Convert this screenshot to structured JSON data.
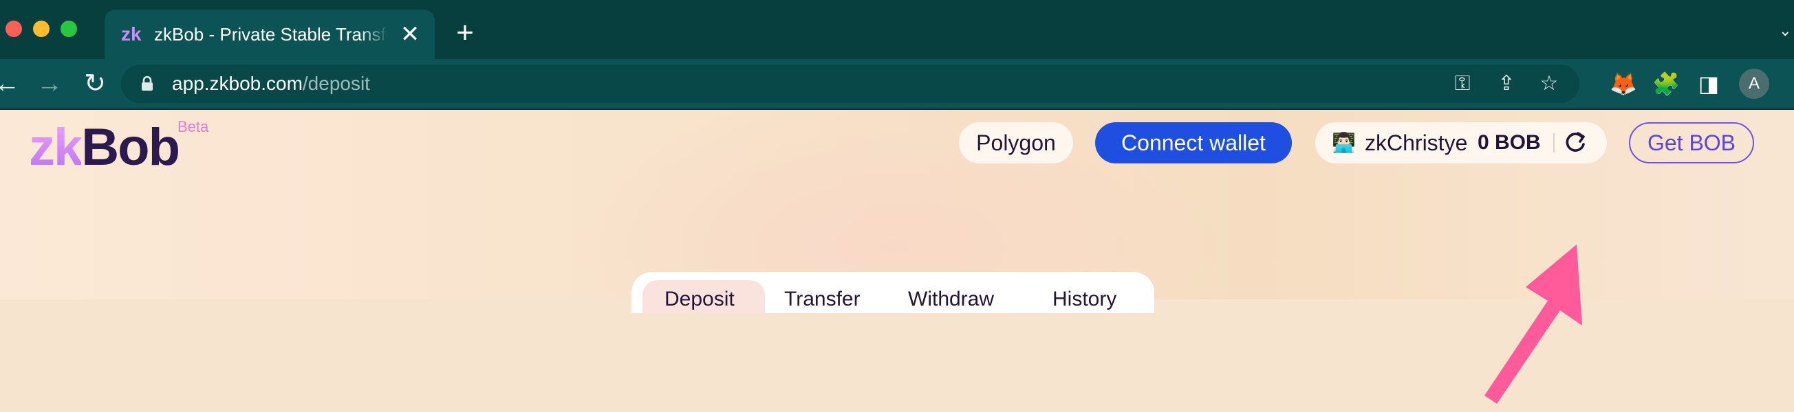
{
  "browser": {
    "tab": {
      "favicon": "zk",
      "title": "zkBob - Private Stable Transfers",
      "close": "✕"
    },
    "new_tab": "+",
    "tab_overflow": "⌄",
    "nav": {
      "back": "←",
      "forward": "→",
      "reload": "↻"
    },
    "url": {
      "host": "app.zkbob.com",
      "path": "/deposit"
    },
    "omnibox_icons": {
      "key": "⚿",
      "share": "⇪",
      "bookmark": "☆"
    },
    "extensions": {
      "metamask": "🦊",
      "puzzle": "🧩",
      "sidepanel": "◨"
    },
    "profile_initial": "A"
  },
  "app": {
    "logo": {
      "zk": "zk",
      "bob": "Bob",
      "beta": "Beta"
    },
    "header": {
      "network": "Polygon",
      "connect": "Connect wallet",
      "account": {
        "avatar": "👨🏻‍💻",
        "name": "zkChristye",
        "balance": "0 BOB"
      },
      "get_bob": "Get BOB"
    },
    "tabs": [
      "Deposit",
      "Transfer",
      "Withdraw",
      "History"
    ]
  },
  "colors": {
    "chrome_dark": "#073f3f",
    "chrome_toolbar": "#0b5354",
    "connect_blue": "#1f4fe0",
    "accent_purple": "#6f53e6",
    "annotation_arrow": "#ff5b9a"
  }
}
